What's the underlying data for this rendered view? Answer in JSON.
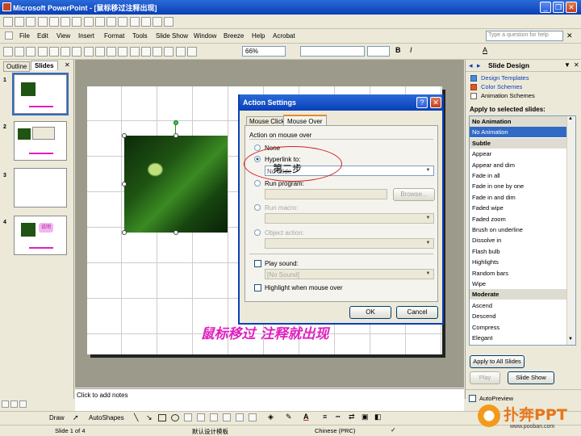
{
  "window": {
    "title": "Microsoft PowerPoint - [鼠标移过注释出现]",
    "minimize": "_",
    "restore": "❐",
    "close": "✕"
  },
  "menu": {
    "items": [
      "File",
      "Edit",
      "View",
      "Insert",
      "Format",
      "Tools",
      "Slide Show",
      "Window",
      "Breeze",
      "Help",
      "Acrobat"
    ],
    "help_placeholder": "Type a question for help"
  },
  "toolbar": {
    "zoom": "66%"
  },
  "left_panel": {
    "tabs": [
      "Outline",
      "Slides"
    ],
    "slide_numbers": [
      "1",
      "2",
      "3",
      "4"
    ],
    "thumb4_label": "说明"
  },
  "slide": {
    "caption": "鼠标移过 注释就出现"
  },
  "dialog": {
    "title": "Action Settings",
    "help_btn": "?",
    "close_btn": "✕",
    "tabs": [
      "Mouse Click",
      "Mouse Over"
    ],
    "group_label": "Action on mouse over",
    "none": "None",
    "hyperlink_to": "Hyperlink to:",
    "hyperlink_value": "No Slide",
    "hyperlink_overlay": "第二步",
    "run_program": "Run program:",
    "browse": "Browse...",
    "run_macro": "Run macro:",
    "object_action": "Object action:",
    "play_sound": "Play sound:",
    "sound_value": "[No Sound]",
    "highlight": "Highlight when mouse over",
    "ok": "OK",
    "cancel": "Cancel"
  },
  "task_pane": {
    "title": "Slide Design",
    "links": [
      "Design Templates",
      "Color Schemes",
      "Animation Schemes"
    ],
    "apply_label": "Apply to selected slides:",
    "list": [
      {
        "text": "No Animation",
        "kind": "hdr"
      },
      {
        "text": "No Animation",
        "kind": "sel"
      },
      {
        "text": "Subtle",
        "kind": "hdr"
      },
      {
        "text": "Appear",
        "kind": "item"
      },
      {
        "text": "Appear and dim",
        "kind": "item"
      },
      {
        "text": "Fade in all",
        "kind": "item"
      },
      {
        "text": "Fade in one by one",
        "kind": "item"
      },
      {
        "text": "Fade in and dim",
        "kind": "item"
      },
      {
        "text": "Faded wipe",
        "kind": "item"
      },
      {
        "text": "Faded zoom",
        "kind": "item"
      },
      {
        "text": "Brush on underline",
        "kind": "item"
      },
      {
        "text": "Dissolve in",
        "kind": "item"
      },
      {
        "text": "Flash bulb",
        "kind": "item"
      },
      {
        "text": "Highlights",
        "kind": "item"
      },
      {
        "text": "Random bars",
        "kind": "item"
      },
      {
        "text": "Wipe",
        "kind": "item"
      },
      {
        "text": "Moderate",
        "kind": "hdr"
      },
      {
        "text": "Ascend",
        "kind": "item"
      },
      {
        "text": "Descend",
        "kind": "item"
      },
      {
        "text": "Compress",
        "kind": "item"
      },
      {
        "text": "Elegant",
        "kind": "item"
      }
    ],
    "apply_all": "Apply to All Slides",
    "play": "Play",
    "slide_show": "Slide Show",
    "autopreview": "AutoPreview"
  },
  "notes": {
    "placeholder": "Click to add notes"
  },
  "drawing": {
    "draw": "Draw",
    "autoshapes": "AutoShapes"
  },
  "status": {
    "slide": "Slide 1 of 4",
    "design": "默认设计模板",
    "language": "Chinese (PRC)"
  },
  "watermark": {
    "brand": "扑奔PPT",
    "url": "www.pooban.com"
  },
  "colors": {
    "accent": "#316ac5",
    "title_blue": "#0a3fb8",
    "caption_magenta": "#e020c0",
    "annotation_red": "#d02020"
  }
}
